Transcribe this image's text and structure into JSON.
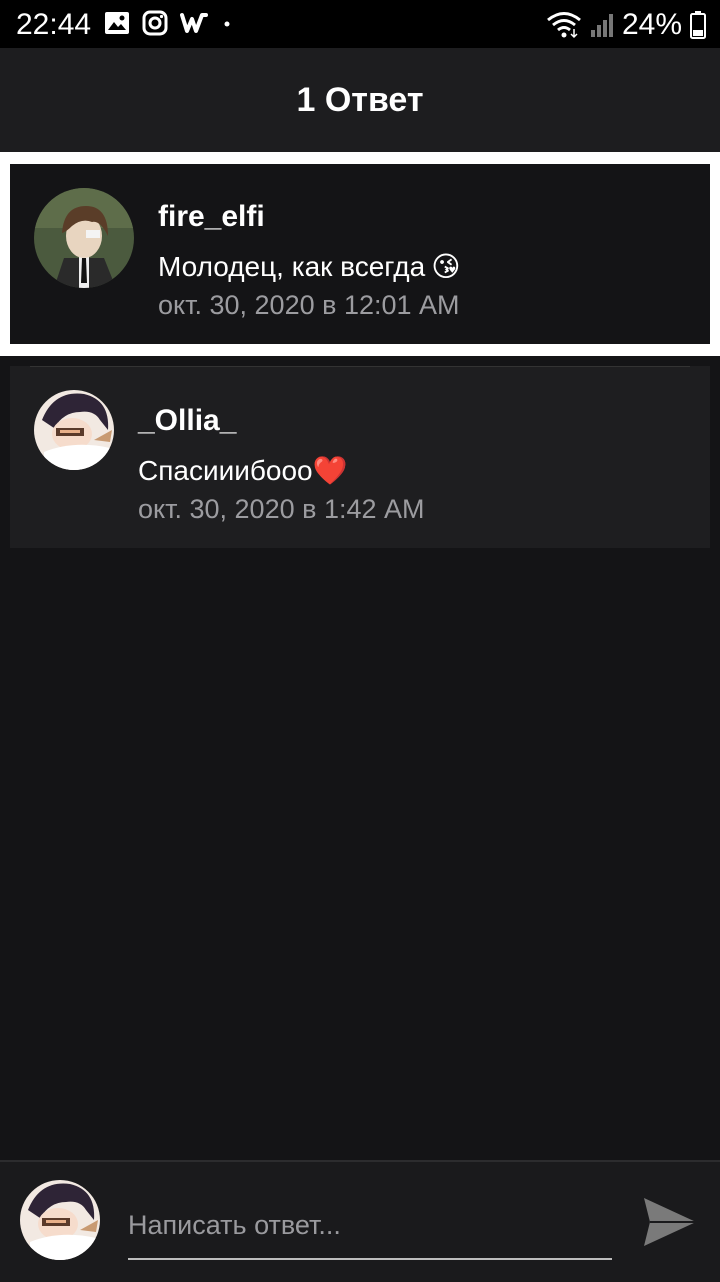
{
  "status_bar": {
    "time": "22:44",
    "battery_percent": "24%",
    "icons": [
      "image-icon",
      "instagram-icon",
      "wattpad-icon",
      "wifi-icon",
      "signal-icon",
      "battery-icon"
    ]
  },
  "header": {
    "title": "1 Ответ"
  },
  "parent_comment": {
    "username": "fire_elfi",
    "message": "Молодец, как всегда",
    "emoji": "😘",
    "timestamp": "окт. 30, 2020 в 12:01 AM"
  },
  "reply": {
    "username": "_Ollia_",
    "message": "Спасииибооо",
    "emoji": "❤️",
    "timestamp": "окт. 30, 2020 в 1:42 AM"
  },
  "composer": {
    "placeholder": "Написать ответ...",
    "send_icon": "send-icon"
  },
  "colors": {
    "background": "#141416",
    "header": "#1d1d1f",
    "card": "#1e1e20",
    "highlight_border": "#ffffff",
    "secondary_text": "#9c9ca0"
  }
}
